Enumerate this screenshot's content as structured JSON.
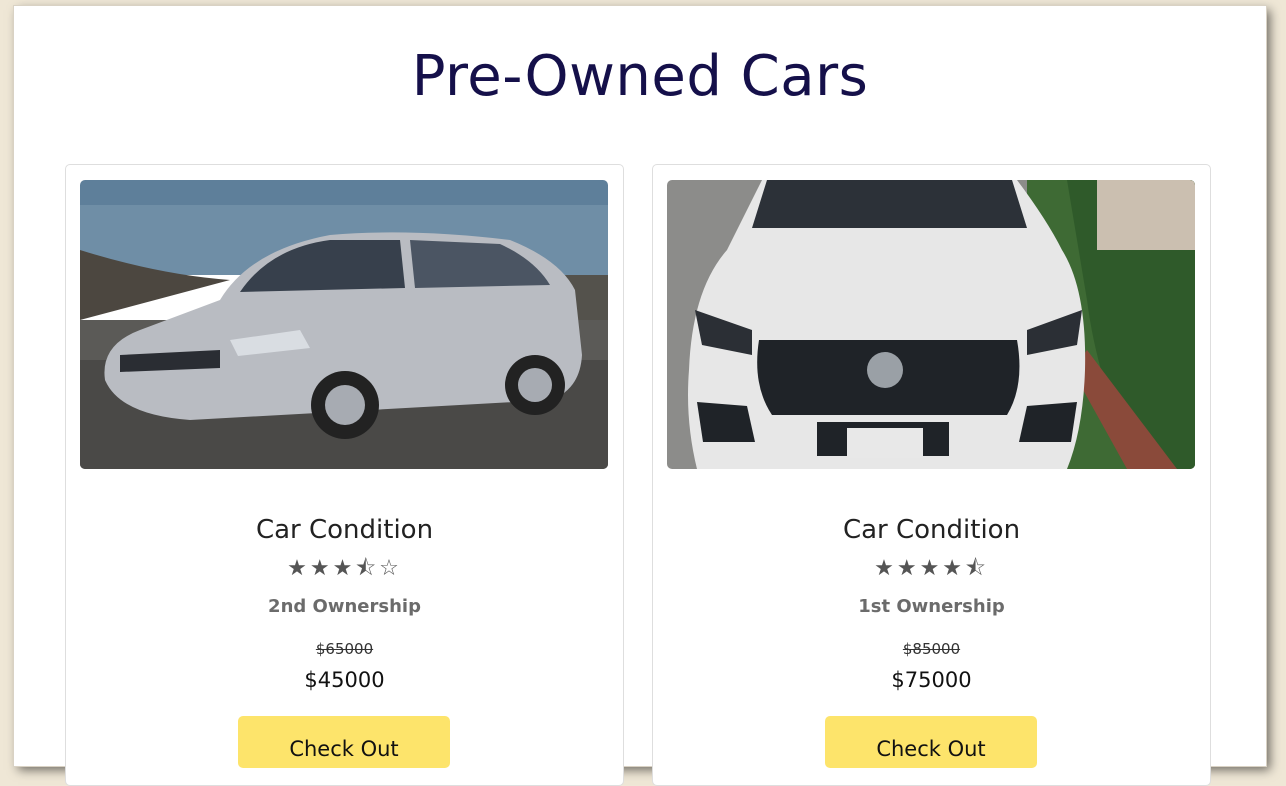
{
  "page": {
    "title": "Pre-Owned Cars"
  },
  "cars": [
    {
      "image": "silver-sedan-photo",
      "condition_label": "Car Condition",
      "rating": 3.5,
      "rating_text": "★★★⯪☆",
      "ownership": "2nd Ownership",
      "old_price": "$65000",
      "new_price": "$45000",
      "button_label": "Check Out"
    },
    {
      "image": "white-suv-photo",
      "condition_label": "Car Condition",
      "rating": 4.5,
      "rating_text": "★★★★⯪",
      "ownership": "1st Ownership",
      "old_price": "$85000",
      "new_price": "$75000",
      "button_label": "Check Out"
    }
  ],
  "colors": {
    "title": "#15104a",
    "button": "#fde46b",
    "background": "#efe7d6"
  }
}
